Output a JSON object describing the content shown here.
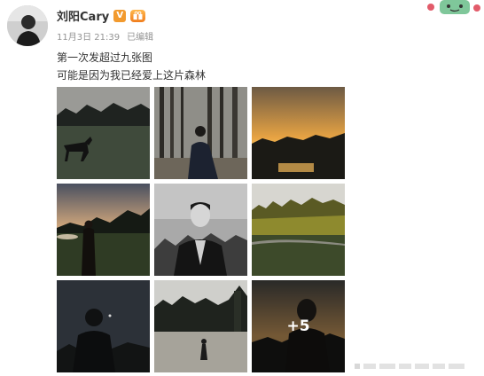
{
  "post": {
    "username": "刘阳Cary",
    "verified_badge": "V",
    "badge_icon": "gift-icon",
    "date": "11月3日 21:39",
    "edited": "已编辑",
    "text_line_1": "第一次发超过九张图",
    "text_line_2": "可能是因为我已经爱上这片森林"
  },
  "gallery": {
    "photo_count": 9,
    "more_label": "+5"
  },
  "colors": {
    "verified": "#f29a2e",
    "username": "#333333",
    "meta": "#939393"
  }
}
